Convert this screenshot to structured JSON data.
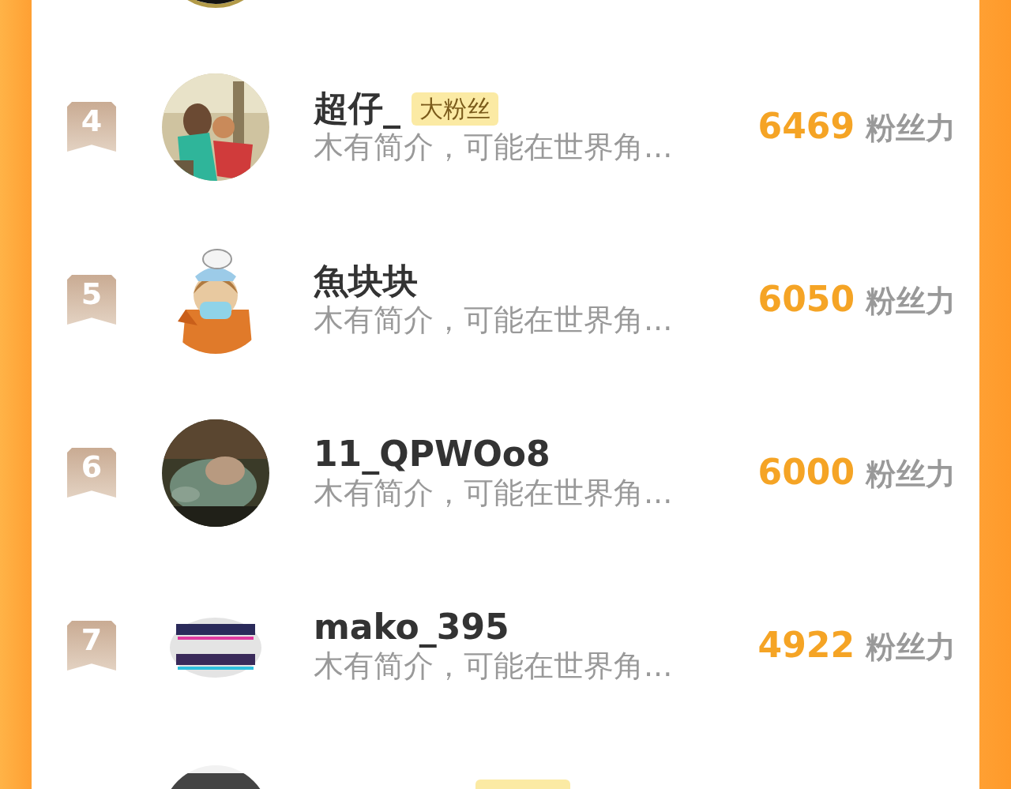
{
  "rows": [
    {
      "avatar": {
        "kind": "picture",
        "ring": true
      }
    },
    {
      "rank": "4",
      "avatar": {
        "kind": "picture",
        "ring": false
      },
      "name": "超仔_",
      "badge": "大粉丝",
      "bio": "木有简介，可能在世界角...",
      "score": "6469",
      "score_unit": "粉丝力"
    },
    {
      "rank": "5",
      "avatar": {
        "kind": "picture",
        "ring": false
      },
      "name": "魚块块",
      "bio": "木有简介，可能在世界角...",
      "score": "6050",
      "score_unit": "粉丝力"
    },
    {
      "rank": "6",
      "avatar": {
        "kind": "picture",
        "ring": false
      },
      "name": "11_QPWOo8",
      "bio": "木有简介，可能在世界角...",
      "score": "6000",
      "score_unit": "粉丝力"
    },
    {
      "rank": "7",
      "avatar": {
        "kind": "picture",
        "ring": false
      },
      "name": "mako_395",
      "bio": "木有简介，可能在世界角...",
      "score": "4922",
      "score_unit": "粉丝力"
    },
    {
      "avatar": {
        "kind": "picture",
        "ring": false
      },
      "badge_strip": true
    }
  ]
}
